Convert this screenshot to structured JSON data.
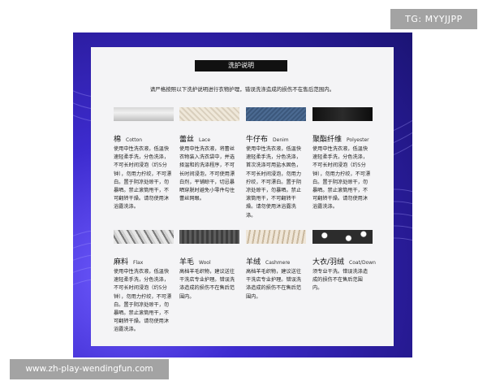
{
  "watermark_top": "TG: MYYJJPP",
  "watermark_bottom": "www.zh-play-wendingfun.com",
  "card": {
    "title": "洗护说明",
    "subtitle": "请严格按照以下洗护说明进行衣物护理，错误洗涤造成的损伤不在售后范围内。"
  },
  "fabrics": [
    {
      "zh": "棉",
      "en": "Cotton",
      "desc": "使用中性洗衣液，低温快速轻柔手洗，分色洗涤，不可长时间浸泡（约5分钟），勿用力拧绞，不可漂白。置于阴凉处晾干，勿暴晒。禁止滚筒甩干，不可翻转干燥。请勿使用沐浴露洗涤。"
    },
    {
      "zh": "蕾丝",
      "en": "Lace",
      "desc": "使用中性洗衣液，将蕾丝衣物装入洗衣袋中，并选择温和的洗涤程序，不可长时间浸泡，不可使用漂白剂，平铺晾干，切忌暴晒穿脱时避免小零件勾住蕾丝网眼。"
    },
    {
      "zh": "牛仔布",
      "en": "Denim",
      "desc": "使用中性洗衣液，低温快速轻柔手洗，分色洗涤，首次洗涤可用盐水固色，不可长时间浸泡，勿用力拧绞，不可漂白。置于阴凉处晾干，勿暴晒。禁止滚筒甩干，不可翻转干燥。请勿使用沐浴露洗涤。"
    },
    {
      "zh": "聚酯纤维",
      "en": "Polyester",
      "desc": "使用中性洗衣液，低温快速轻柔手洗，分色洗涤，不可长时间浸泡（约5分钟），勿用力拧绞，不可漂白。置于阴凉处晾干，勿暴晒。禁止滚筒甩干，不可翻转干燥。请勿使用沐浴露洗涤。"
    },
    {
      "zh": "麻料",
      "en": "Flax",
      "desc": "使用中性洗衣液，低温快速轻柔手洗，分色洗涤，不可长时间浸泡（约5分钟），勿用力拧绞，不可漂白。置于阴凉处晾干，勿暴晒。禁止滚筒甩干，不可翻转干燥。请勿使用沐浴露洗涤。"
    },
    {
      "zh": "羊毛",
      "en": "Wool",
      "desc": "高档羊毛织物，建议送往干洗店专业护理。错误洗涤造成的损伤不在售后范围内。"
    },
    {
      "zh": "羊绒",
      "en": "Cashmere",
      "desc": "高档羊毛织物，建议送往干洗店专业护理。错误洗涤造成的损伤不在售后范围内。"
    },
    {
      "zh": "大衣/羽绒",
      "en": "Coat/Down",
      "desc": "须专业干洗。错误洗涤造成的损伤不在售后范围内。"
    }
  ]
}
